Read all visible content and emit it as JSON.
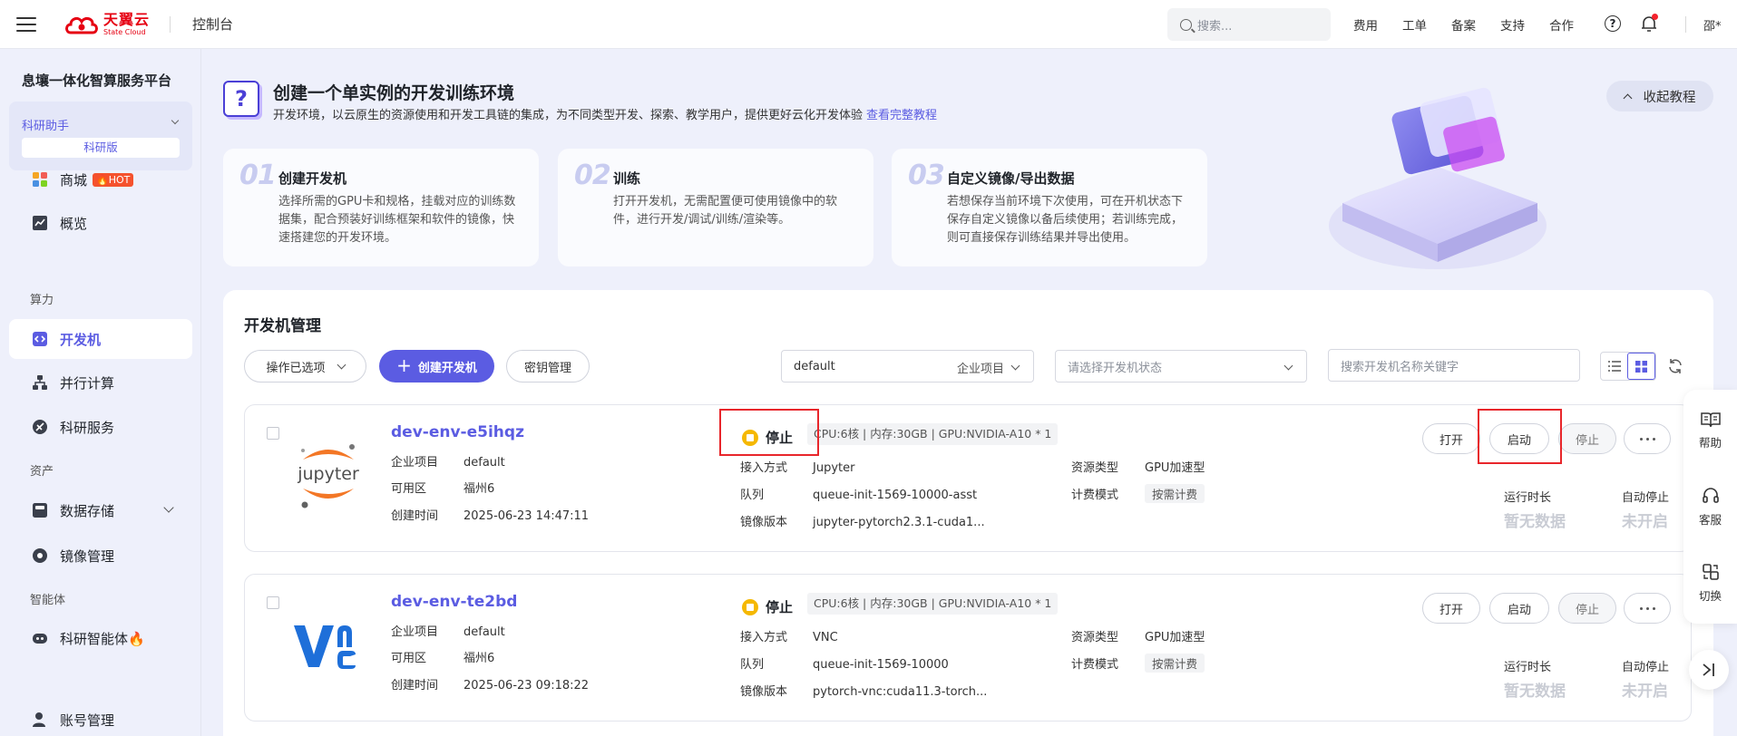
{
  "topbar": {
    "logo_cn": "天翼云",
    "logo_en": "State Cloud",
    "console": "控制台",
    "search_placeholder": "搜索...",
    "links": [
      "费用",
      "工单",
      "备案",
      "支持",
      "合作"
    ],
    "user": "邵*"
  },
  "sidebar": {
    "platform": "息壤一体化智算服务平台",
    "assistant": "科研助手",
    "edition": "科研版",
    "items": [
      {
        "label": "商城",
        "badge": "🔥HOT"
      },
      {
        "label": "概览"
      },
      {
        "label": "开发机"
      },
      {
        "label": "并行计算"
      },
      {
        "label": "科研服务"
      },
      {
        "label": "数据存储"
      },
      {
        "label": "镜像管理"
      },
      {
        "label": "科研智能体🔥"
      },
      {
        "label": "账号管理"
      }
    ],
    "sections": [
      "算力",
      "资产",
      "智能体"
    ]
  },
  "banner": {
    "title": "创建一个单实例的开发训练环境",
    "desc": "开发环境，以云原生的资源使用和开发工具链的集成，为不同类型开发、探索、教学用户，提供更好云化开发体验",
    "link": "查看完整教程",
    "collapse": "收起教程",
    "steps": [
      {
        "num": "01",
        "title": "创建开发机",
        "desc": "选择所需的GPU卡和规格，挂载对应的训练数据集，配合预装好训练框架和软件的镜像，快速搭建您的开发环境。"
      },
      {
        "num": "02",
        "title": "训练",
        "desc": "打开开发机，无需配置便可使用镜像中的软件，进行开发/调试/训练/渲染等。"
      },
      {
        "num": "03",
        "title": "自定义镜像/导出数据",
        "desc": "若想保存当前环境下次使用，可在开机状态下保存自定义镜像以备后续使用；若训练完成，则可直接保存训练结果并导出使用。"
      }
    ]
  },
  "panel": {
    "title": "开发机管理",
    "ops": "操作已选项",
    "create": "创建开发机",
    "keys": "密钥管理",
    "project_value": "default",
    "project_label": "企业项目",
    "status_placeholder": "请选择开发机状态",
    "search_placeholder": "搜索开发机名称关键字"
  },
  "labels": {
    "project": "企业项目",
    "zone": "可用区",
    "created": "创建时间",
    "access": "接入方式",
    "queue": "队列",
    "image": "镜像版本",
    "res_type": "资源类型",
    "billing": "计费模式",
    "runtime": "运行时长",
    "autostop": "自动停止",
    "open": "打开",
    "start": "启动",
    "stop": "停止"
  },
  "envs": [
    {
      "name": "dev-env-e5ihqz",
      "project": "default",
      "zone": "福州6",
      "created": "2025-06-23 14:47:11",
      "status": "停止",
      "spec": "CPU:6核 | 内存:30GB | GPU:NVIDIA-A10 * 1",
      "access": "Jupyter",
      "queue": "queue-init-1569-10000-asst",
      "image": "jupyter-pytorch2.3.1-cuda1...",
      "res_type": "GPU加速型",
      "billing": "按需计费",
      "runtime": "暂无数据",
      "autostop": "未开启",
      "logo": "jupyter"
    },
    {
      "name": "dev-env-te2bd",
      "project": "default",
      "zone": "福州6",
      "created": "2025-06-23 09:18:22",
      "status": "停止",
      "spec": "CPU:6核 | 内存:30GB | GPU:NVIDIA-A10 * 1",
      "access": "VNC",
      "queue": "queue-init-1569-10000",
      "image": "pytorch-vnc:cuda11.3-torch...",
      "res_type": "GPU加速型",
      "billing": "按需计费",
      "runtime": "暂无数据",
      "autostop": "未开启",
      "logo": "vnc"
    }
  ],
  "float": {
    "help": "帮助",
    "service": "客服",
    "switch": "切换"
  },
  "colors": {
    "accent": "#5b5ce2",
    "status_stopped": "#f5b800",
    "highlight": "#e8262b"
  }
}
